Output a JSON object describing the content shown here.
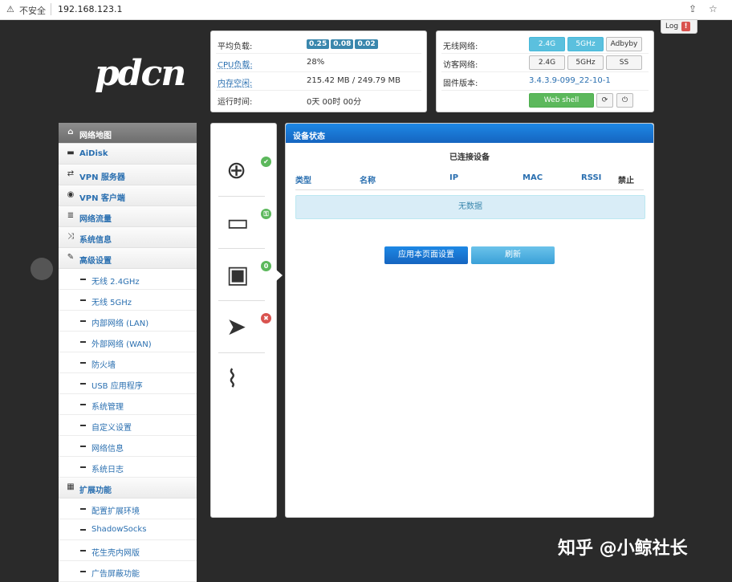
{
  "browser": {
    "security": "不安全",
    "url": "192.168.123.1"
  },
  "logo": "pdcn",
  "log_button": {
    "label": "Log",
    "alert": "!"
  },
  "system": {
    "rows": [
      {
        "key": "平均负载:",
        "badges": [
          "0.25",
          "0.08",
          "0.02"
        ]
      },
      {
        "key": "CPU负载:",
        "value": "28%"
      },
      {
        "key": "内存空闲:",
        "value": "215.42 MB / 249.79 MB"
      },
      {
        "key": "运行时间:",
        "value": "0天 00时 00分"
      }
    ]
  },
  "wireless": {
    "rows": [
      {
        "key": "无线网络:",
        "buttons": [
          "2.4G",
          "5GHz",
          "Adbyby"
        ]
      },
      {
        "key": "访客网络:",
        "buttons": [
          "2.4G",
          "5GHz",
          "SS"
        ]
      },
      {
        "key": "固件版本:",
        "value": "3.4.3.9-099_22-10-1"
      }
    ],
    "webshell": "Web shell"
  },
  "sidebar": {
    "main": [
      {
        "label": "网络地图",
        "icon": "home-icon"
      },
      {
        "label": "AiDisk",
        "icon": "disk-icon"
      },
      {
        "label": "VPN 服务器",
        "icon": "retweet-icon"
      },
      {
        "label": "VPN 客户端",
        "icon": "globe-icon"
      },
      {
        "label": "网络流量",
        "icon": "list-icon"
      },
      {
        "label": "系统信息",
        "icon": "shuffle-icon"
      },
      {
        "label": "高级设置",
        "icon": "wrench-icon"
      }
    ],
    "advanced": [
      "无线 2.4GHz",
      "无线 5GHz",
      "内部网络 (LAN)",
      "外部网络 (WAN)",
      "防火墙",
      "USB 应用程序",
      "系统管理",
      "自定义设置",
      "网络信息",
      "系统日志"
    ],
    "ext_header": "扩展功能",
    "extensions": [
      "配置扩展环境",
      "ShadowSocks",
      "花生壳内网版",
      "广告屏蔽功能"
    ]
  },
  "status_icons": {
    "internet": {
      "icon": "globe-network-icon",
      "status": "ok"
    },
    "wireless": {
      "icon": "wifi-lock-icon",
      "status": "locked"
    },
    "clients": {
      "icon": "devices-icon",
      "count": "0"
    },
    "vpn": {
      "icon": "paper-plane-icon",
      "status": "error"
    },
    "usb": {
      "icon": "usb-icon"
    }
  },
  "device_status": {
    "title": "设备状态",
    "subtitle": "已连接设备",
    "columns": [
      "类型",
      "名称",
      "IP",
      "MAC",
      "RSSI",
      "禁止"
    ],
    "empty": "无数据",
    "apply_label": "应用本页面设置",
    "refresh_label": "刷新"
  },
  "watermark": "知乎 @小鲸社长",
  "colors": {
    "header_blue": "#1565c0",
    "badge_blue": "#3a87ad",
    "on_button": "#5bc0de",
    "green": "#5cb85c"
  }
}
